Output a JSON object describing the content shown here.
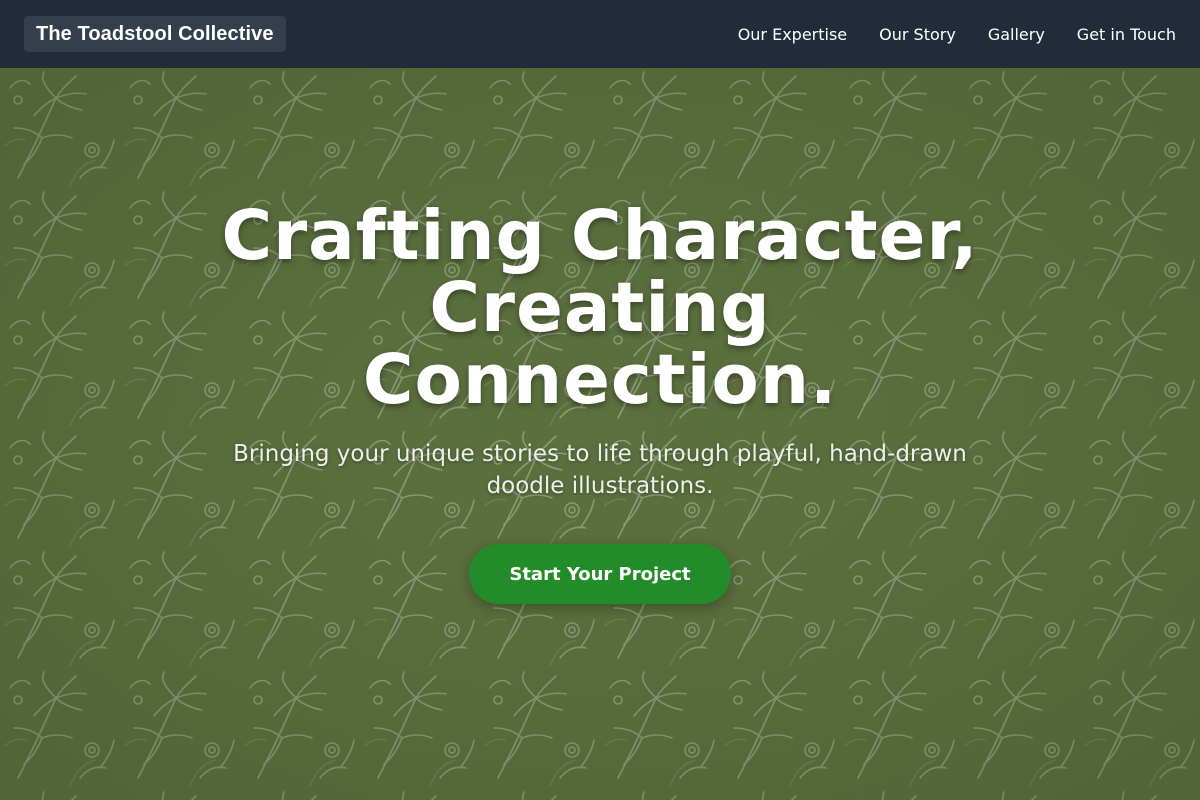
{
  "header": {
    "logo": "The Toadstool Collective",
    "nav": [
      {
        "label": "Our Expertise"
      },
      {
        "label": "Our Story"
      },
      {
        "label": "Gallery"
      },
      {
        "label": "Get in Touch"
      }
    ]
  },
  "hero": {
    "headline": "Crafting Character, Creating Connection.",
    "subtitle": "Bringing your unique stories to life through playful, hand-drawn doodle illustrations.",
    "cta": "Start Your Project",
    "background_pattern": "fern-leaf-doodle-pattern"
  },
  "colors": {
    "nav_background": "#222b3a",
    "logo_background": "#343e4d",
    "hero_background": "#5e7340",
    "pattern_stroke": "#c9d0c0",
    "cta_background": "#238c2a",
    "text": "#ffffff"
  }
}
